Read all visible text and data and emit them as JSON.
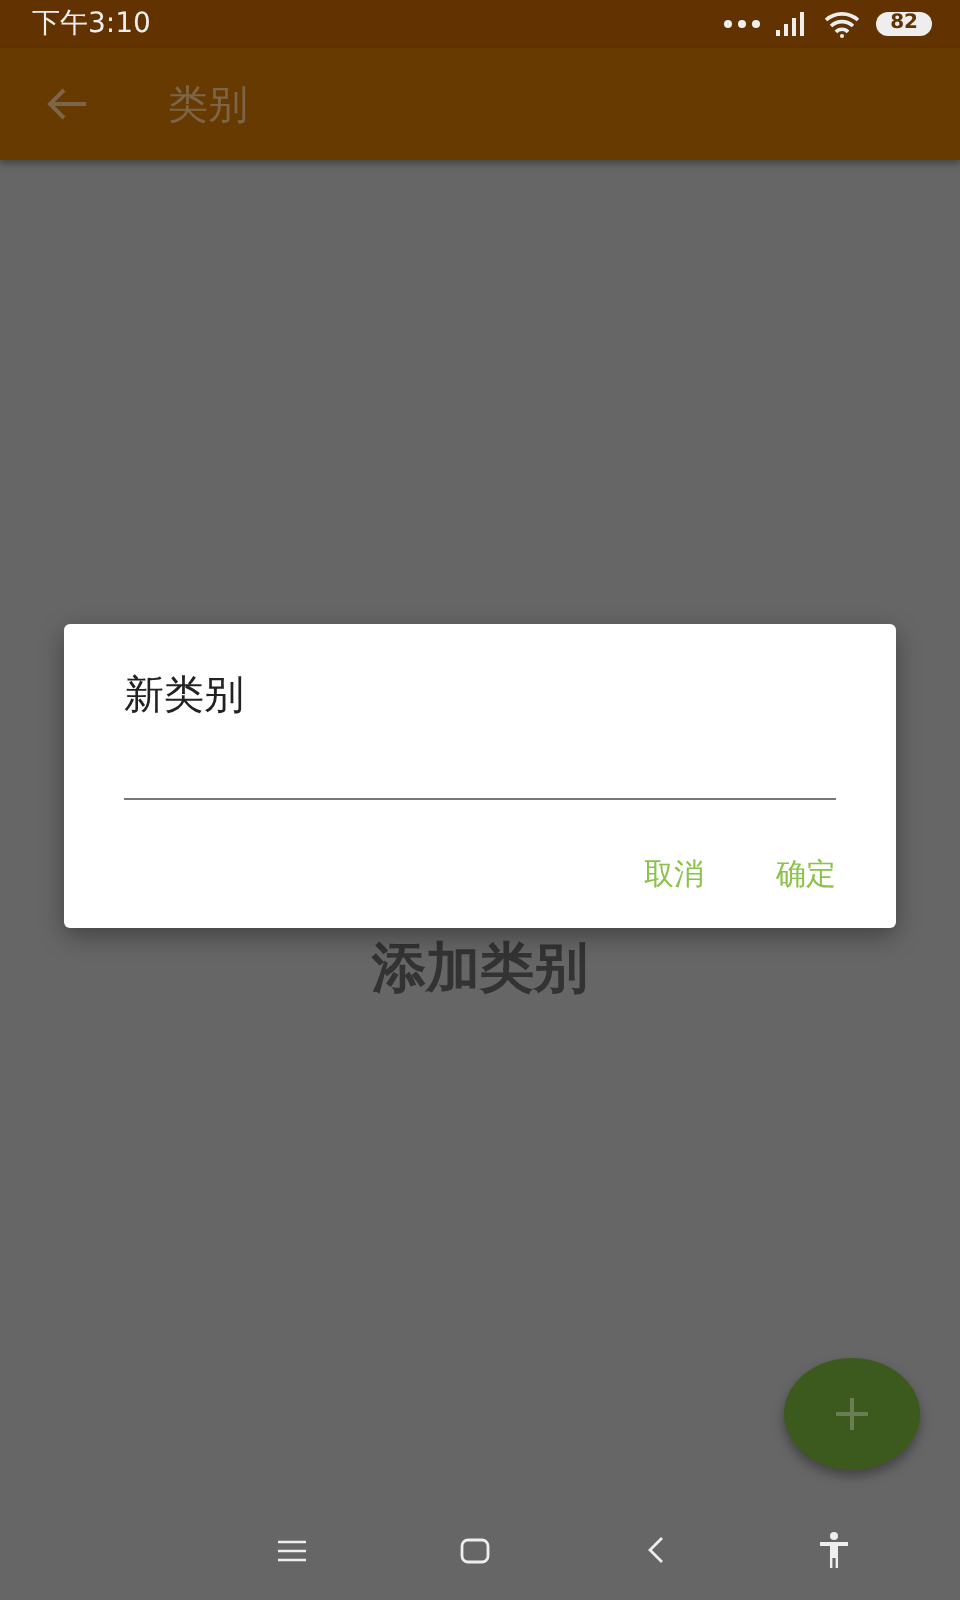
{
  "status_bar": {
    "time": "下午3:10",
    "battery": "82"
  },
  "app_bar": {
    "title": "类别"
  },
  "empty_state": {
    "text": "添加类别"
  },
  "dialog": {
    "title": "新类别",
    "buttons": [
      "取消",
      "确定"
    ]
  }
}
